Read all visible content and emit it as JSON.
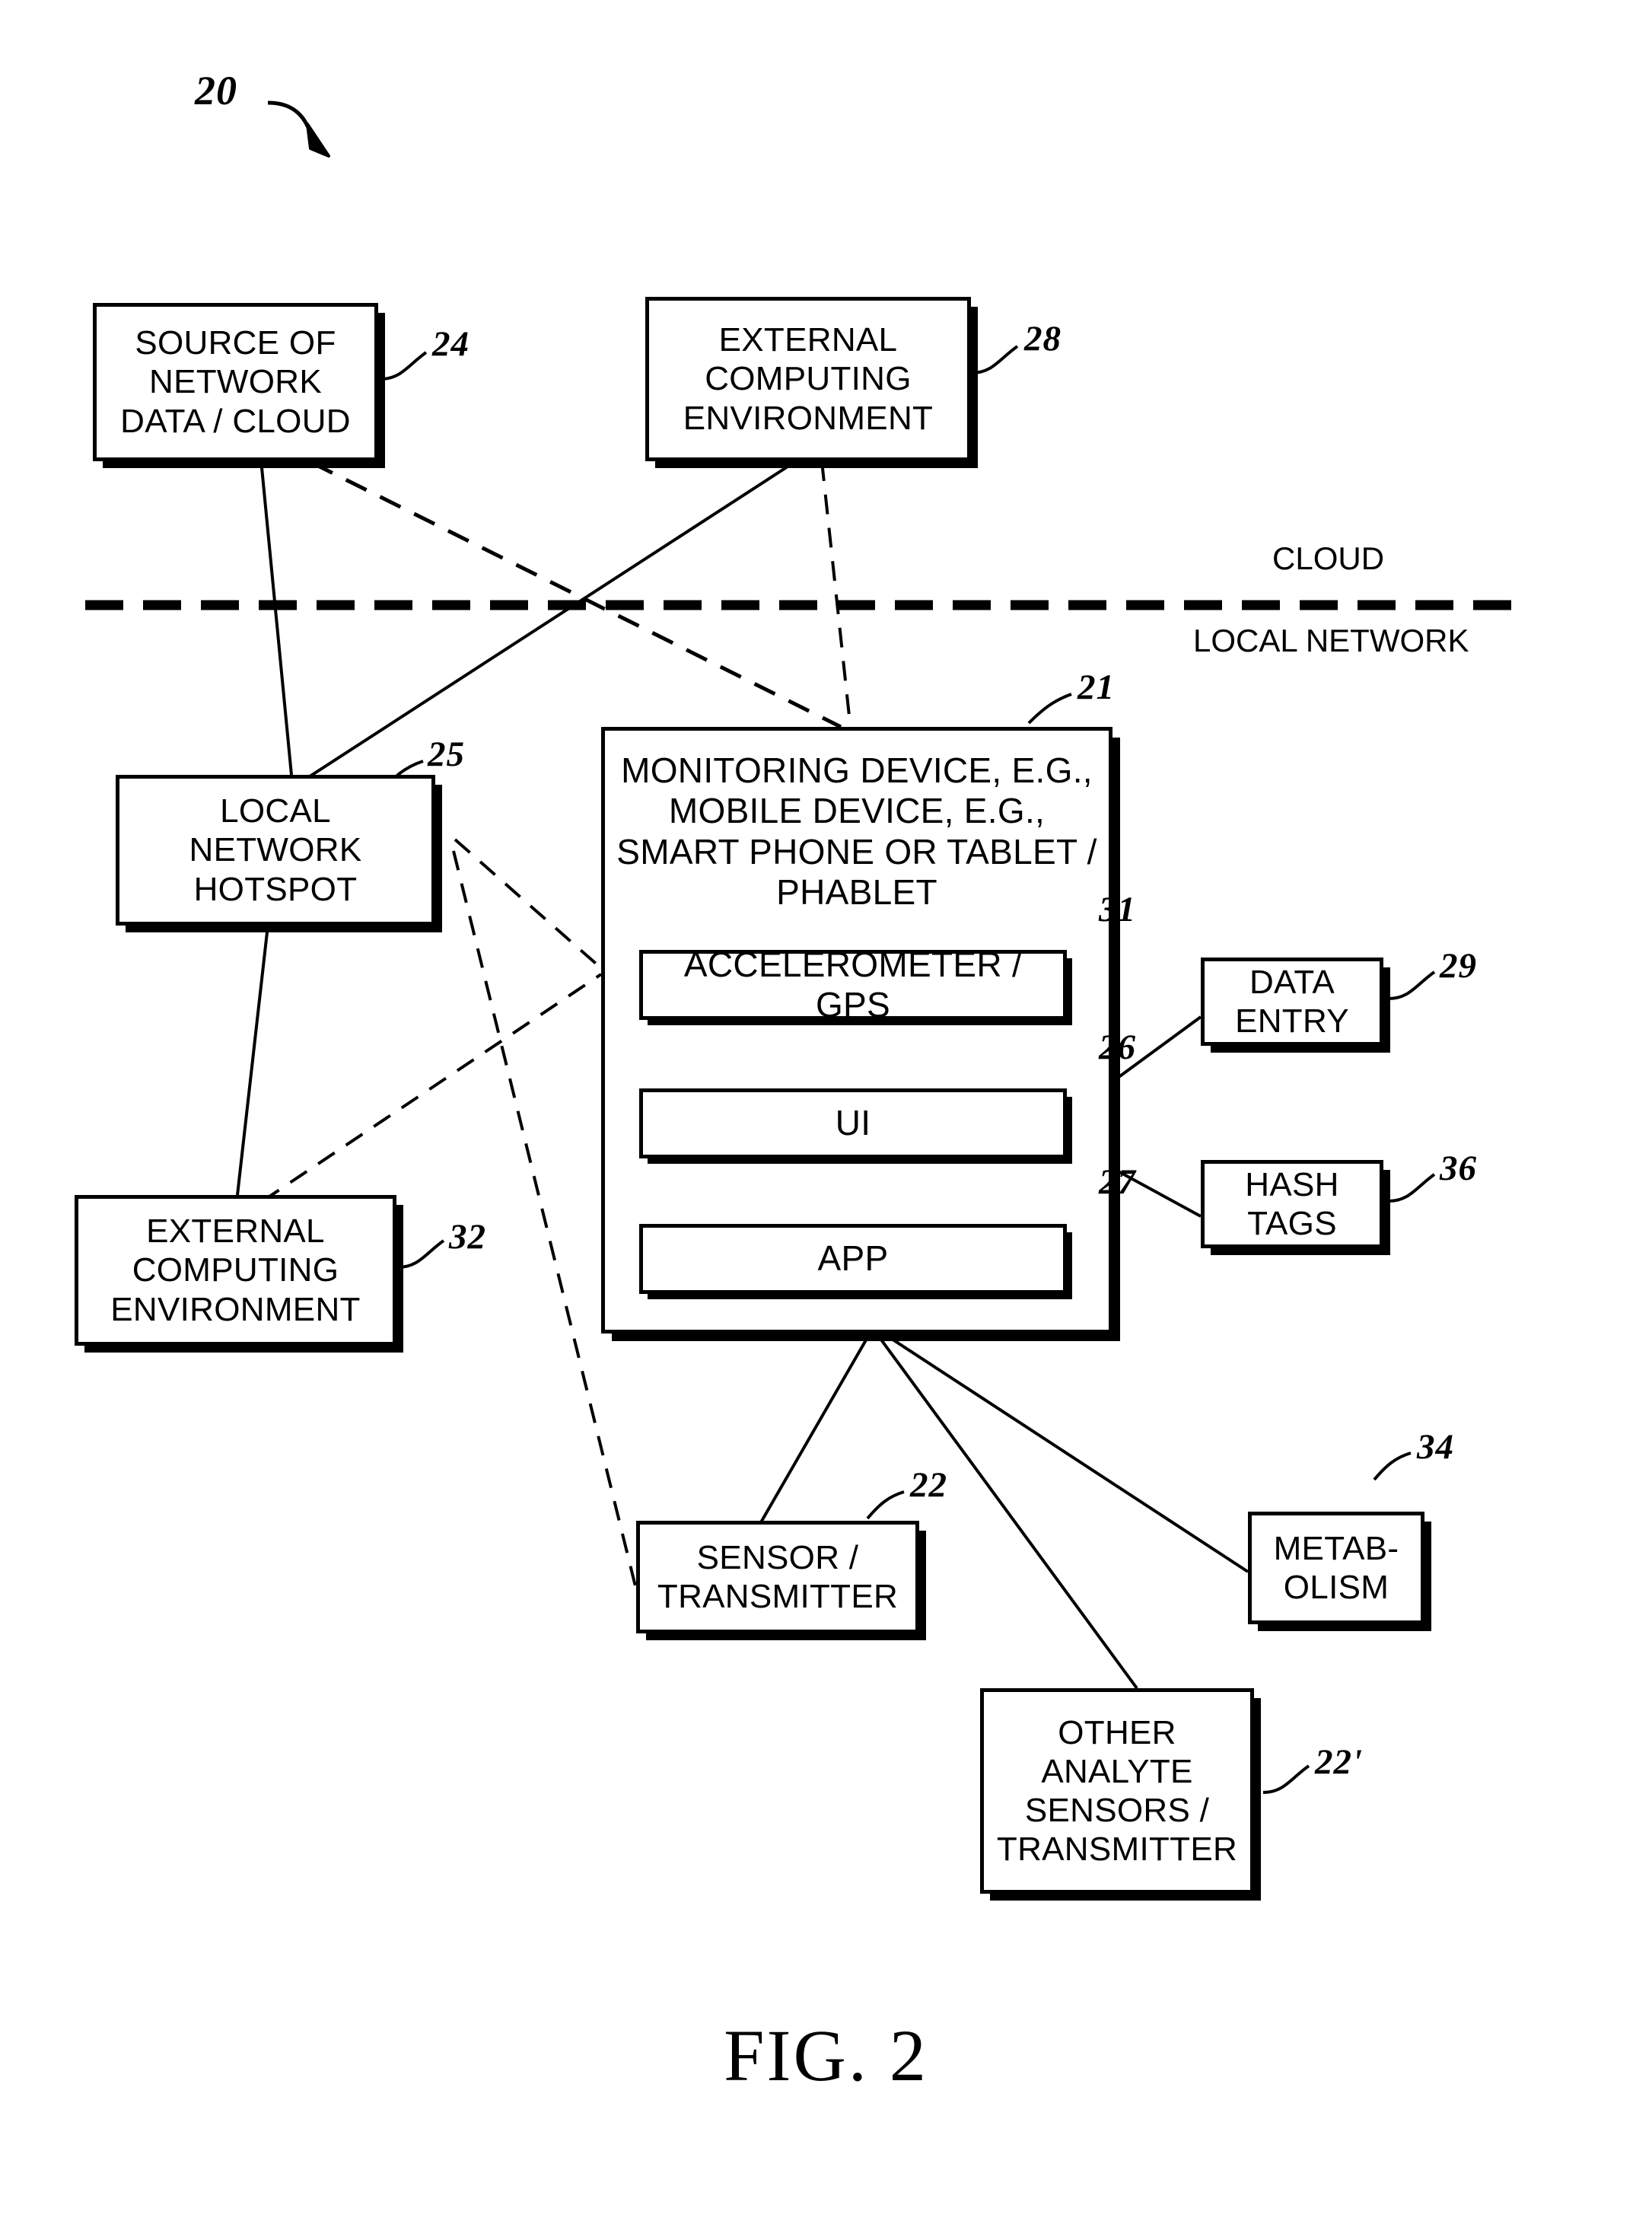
{
  "figure": {
    "caption": "FIG. 2",
    "system_ref": "20"
  },
  "divider": {
    "above_label": "CLOUD",
    "below_label": "LOCAL NETWORK"
  },
  "boxes": [
    {
      "id": "source-of-network-data-cloud",
      "label": "SOURCE OF\nNETWORK\nDATA / CLOUD",
      "ref": "24"
    },
    {
      "id": "external-computing-environment-cloud",
      "label": "EXTERNAL\nCOMPUTING\nENVIRONMENT",
      "ref": "28"
    },
    {
      "id": "local-network-hotspot",
      "label": "LOCAL\nNETWORK\nHOTSPOT",
      "ref": "25"
    },
    {
      "id": "monitoring-device",
      "label": "MONITORING DEVICE, E.G.,\nMOBILE DEVICE, E.G.,\nSMART PHONE OR TABLET /\nPHABLET",
      "ref": "21"
    },
    {
      "id": "accelerometer-gps",
      "label": "ACCELEROMETER / GPS",
      "ref": "31"
    },
    {
      "id": "ui",
      "label": "UI",
      "ref": "26"
    },
    {
      "id": "app",
      "label": "APP",
      "ref": "27"
    },
    {
      "id": "data-entry",
      "label": "DATA\nENTRY",
      "ref": "29"
    },
    {
      "id": "hash-tags",
      "label": "HASH\nTAGS",
      "ref": "36"
    },
    {
      "id": "external-computing-environment-local",
      "label": "EXTERNAL\nCOMPUTING\nENVIRONMENT",
      "ref": "32"
    },
    {
      "id": "sensor-transmitter",
      "label": "SENSOR /\nTRANSMITTER",
      "ref": "22"
    },
    {
      "id": "metabolism",
      "label": "METAB-\nOLISM",
      "ref": "34"
    },
    {
      "id": "other-analyte-sensors-transmitter",
      "label": "OTHER\nANALYTE\nSENSORS /\nTRANSMITTER",
      "ref": "22'"
    }
  ],
  "colors": {
    "line": "#000000",
    "background": "#ffffff"
  }
}
